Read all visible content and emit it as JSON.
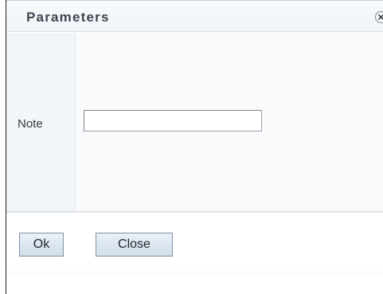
{
  "dialog": {
    "title": "Parameters",
    "close_icon": "close-circle-icon"
  },
  "form": {
    "note_label": "Note",
    "note_value": "",
    "note_placeholder": ""
  },
  "buttons": {
    "ok_label": "Ok",
    "close_label": "Close"
  },
  "colors": {
    "title_text": "#3d4652",
    "title_bg": "#f1f4f7",
    "button_border": "#7f92a7",
    "button_fill": "#dde7f0",
    "label_column_bg": "#f3f6f8"
  }
}
